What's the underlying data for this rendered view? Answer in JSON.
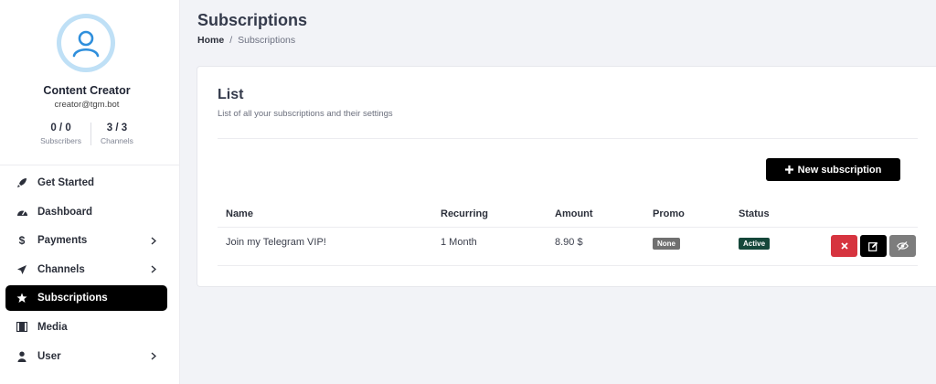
{
  "profile": {
    "name": "Content Creator",
    "email": "creator@tgm.bot",
    "stats": [
      {
        "value": "0 / 0",
        "label": "Subscribers"
      },
      {
        "value": "3 / 3",
        "label": "Channels"
      }
    ]
  },
  "sidebar": {
    "items": [
      {
        "label": "Get Started",
        "icon": "rocket-icon",
        "chevron": false,
        "active": false
      },
      {
        "label": "Dashboard",
        "icon": "gauge-icon",
        "chevron": false,
        "active": false
      },
      {
        "label": "Payments",
        "icon": "dollar-icon",
        "chevron": true,
        "active": false
      },
      {
        "label": "Channels",
        "icon": "paper-plane-icon",
        "chevron": true,
        "active": false
      },
      {
        "label": "Subscriptions",
        "icon": "star-icon",
        "chevron": false,
        "active": true
      },
      {
        "label": "Media",
        "icon": "film-icon",
        "chevron": false,
        "active": false
      },
      {
        "label": "User",
        "icon": "user-icon",
        "chevron": true,
        "active": false
      }
    ]
  },
  "header": {
    "title": "Subscriptions",
    "breadcrumb": {
      "home": "Home",
      "separator": "/",
      "current": "Subscriptions"
    }
  },
  "card": {
    "title": "List",
    "subtitle": "List of all your subscriptions and their settings",
    "new_button_label": "New subscription"
  },
  "table": {
    "columns": [
      "Name",
      "Recurring",
      "Amount",
      "Promo",
      "Status"
    ],
    "rows": [
      {
        "name": "Join my Telegram VIP!",
        "recurring": "1 Month",
        "amount": "8.90 $",
        "promo": "None",
        "status": "Active"
      }
    ]
  },
  "colors": {
    "accent": "#000000",
    "avatar_bg": "#bfe0f6",
    "avatar_icon": "#2f8fdc",
    "delete": "#d6343f",
    "view": "#7d7d7d",
    "status_active": "#15473a",
    "promo_none": "#707070"
  }
}
